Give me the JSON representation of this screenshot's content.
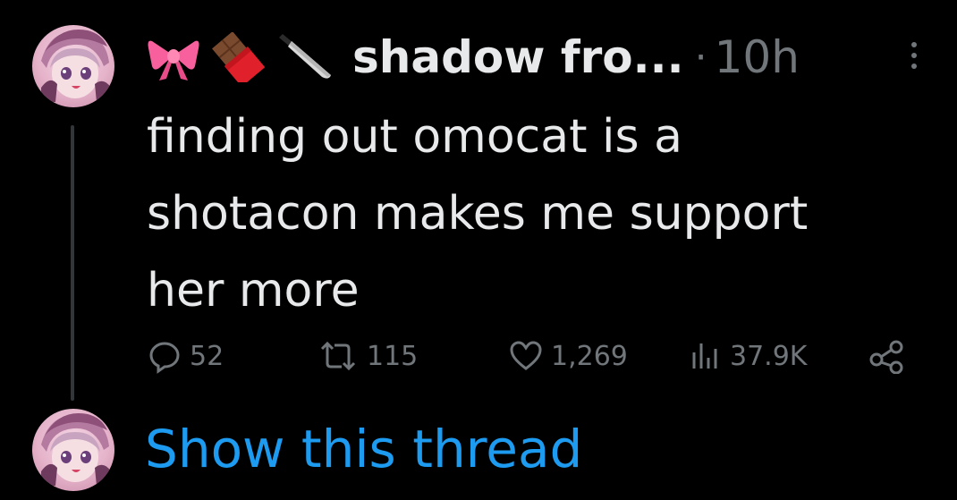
{
  "tweet": {
    "emoji_prefix": [
      "🎀",
      "🍫",
      "🔪"
    ],
    "display_name": "shadow fro...",
    "separator": "·",
    "time": "10h",
    "text": "finding out omocat is a\nshotacon makes me support\nher more"
  },
  "actions": {
    "replies": "52",
    "retweets": "115",
    "likes": "1,269",
    "views": "37.9K"
  },
  "thread": {
    "show_label": "Show this thread"
  },
  "icons": {
    "reply": "reply-icon",
    "retweet": "retweet-icon",
    "like": "heart-icon",
    "views": "views-icon",
    "share": "share-icon",
    "more": "more-icon"
  },
  "colors": {
    "background": "#000000",
    "text": "#e7e9ea",
    "muted": "#71767b",
    "link": "#1d9bf0",
    "thread_line": "#333639"
  }
}
